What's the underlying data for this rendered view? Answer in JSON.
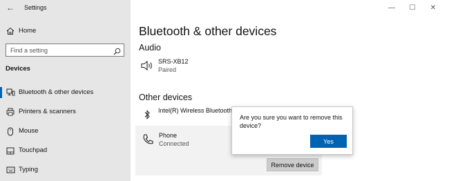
{
  "window": {
    "title": "Settings",
    "back_glyph": "←",
    "minimize_glyph": "—",
    "maximize_glyph": "☐",
    "close_glyph": "✕"
  },
  "sidebar": {
    "home_label": "Home",
    "search_placeholder": "Find a setting",
    "section_label": "Devices",
    "items": [
      {
        "label": "Bluetooth & other devices",
        "icon": "bluetooth-devices-icon",
        "active": true
      },
      {
        "label": "Printers & scanners",
        "icon": "printer-icon"
      },
      {
        "label": "Mouse",
        "icon": "mouse-icon"
      },
      {
        "label": "Touchpad",
        "icon": "touchpad-icon"
      },
      {
        "label": "Typing",
        "icon": "keyboard-icon"
      }
    ]
  },
  "main": {
    "title": "Bluetooth & other devices",
    "audio_heading": "Audio",
    "audio_device": {
      "name": "SRS-XB12",
      "status": "Paired",
      "icon": "speaker-icon"
    },
    "other_heading": "Other devices",
    "other_devices": [
      {
        "name": "Intel(R) Wireless Bluetootho",
        "icon": "bluetooth-icon"
      },
      {
        "name": "Phone",
        "status": "Connected",
        "icon": "phone-icon"
      }
    ],
    "remove_button_label": "Remove device"
  },
  "dialog": {
    "message": "Are you sure you want to remove this device?",
    "yes_label": "Yes"
  },
  "colors": {
    "accent": "#0063b1",
    "sidebar_bg": "#e6e6e6",
    "selected_row_bg": "#f2f2f2"
  }
}
